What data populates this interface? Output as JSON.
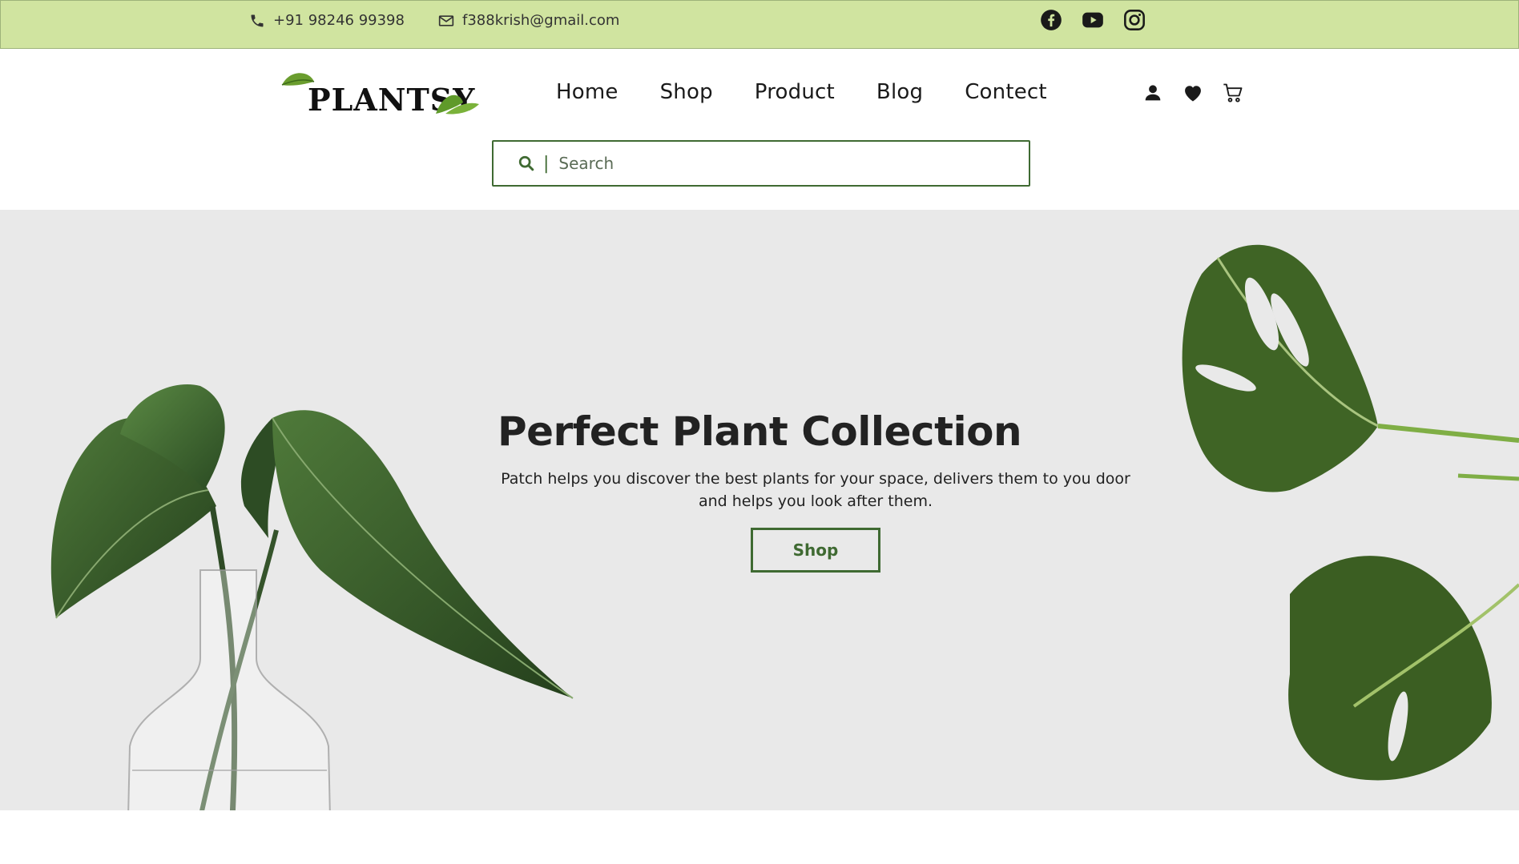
{
  "topbar": {
    "phone": "+91 98246 99398",
    "email": "f388krish@gmail.com",
    "socials": [
      "facebook-icon",
      "youtube-icon",
      "instagram-icon"
    ]
  },
  "header": {
    "logo_text": "PLANTSY",
    "nav": [
      {
        "label": "Home"
      },
      {
        "label": "Shop"
      },
      {
        "label": "Product"
      },
      {
        "label": "Blog"
      },
      {
        "label": "Contect"
      }
    ],
    "icons": [
      "user-icon",
      "heart-icon",
      "cart-icon"
    ]
  },
  "search": {
    "placeholder": "Search",
    "value": ""
  },
  "hero": {
    "title": "Perfect Plant Collection",
    "description": "Patch helps you discover the best plants for your space, delivers them to you door and helps you look after them.",
    "cta_label": "Shop"
  },
  "colors": {
    "topbar_bg": "#d0e4a0",
    "accent_green": "#3f6a32",
    "hero_bg": "#e9e9e9",
    "text_dark": "#222222"
  }
}
